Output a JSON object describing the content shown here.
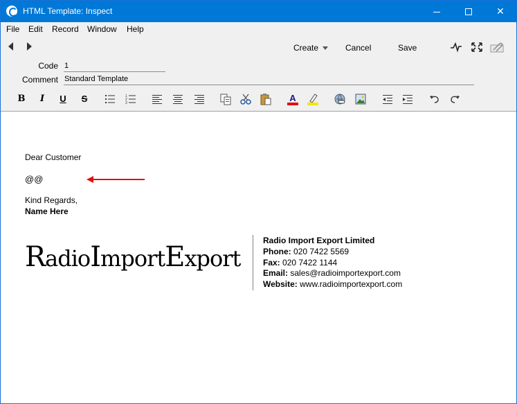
{
  "window": {
    "title": "HTML Template: Inspect",
    "controls": {
      "minimize": "",
      "maximize": "",
      "close": "✕"
    }
  },
  "menu": [
    "File",
    "Edit",
    "Record",
    "Window",
    "Help"
  ],
  "toolbar": {
    "create_label": "Create",
    "cancel_label": "Cancel",
    "save_label": "Save"
  },
  "form": {
    "code_label": "Code",
    "code_value": "1",
    "comment_label": "Comment",
    "comment_value": "Standard Template"
  },
  "format": {
    "bold": "B",
    "italic": "I",
    "underline": "U",
    "strike": "S",
    "font_color": "A"
  },
  "icons": {
    "app": "app-icon",
    "back": "back-arrow-icon",
    "forward": "forward-arrow-icon",
    "chart": "activity-icon",
    "fullscreen": "expand-icon",
    "attach": "paperclip-icon"
  },
  "colors": {
    "title_bar": "#0078d7",
    "arrow": "#e01010",
    "font_color_bar": "#e01010",
    "highlight_bar": "#f0e800"
  },
  "editor": {
    "greeting": "Dear Customer",
    "placeholder": "@@",
    "closing": "Kind Regards,",
    "name": "Name Here",
    "logo": {
      "r": "R",
      "adio": "adio",
      "i": "I",
      "mport": "mport",
      "e": "E",
      "xport": "xport"
    },
    "signature": {
      "company": "Radio Import Export Limited",
      "phone_label": "Phone:",
      "phone": "020 7422 5569",
      "fax_label": "Fax:",
      "fax": "020 7422 1144",
      "email_label": "Email:",
      "email": "sales@radioimportexport.com",
      "website_label": "Website:",
      "website": "www.radioimportexport.com"
    }
  }
}
